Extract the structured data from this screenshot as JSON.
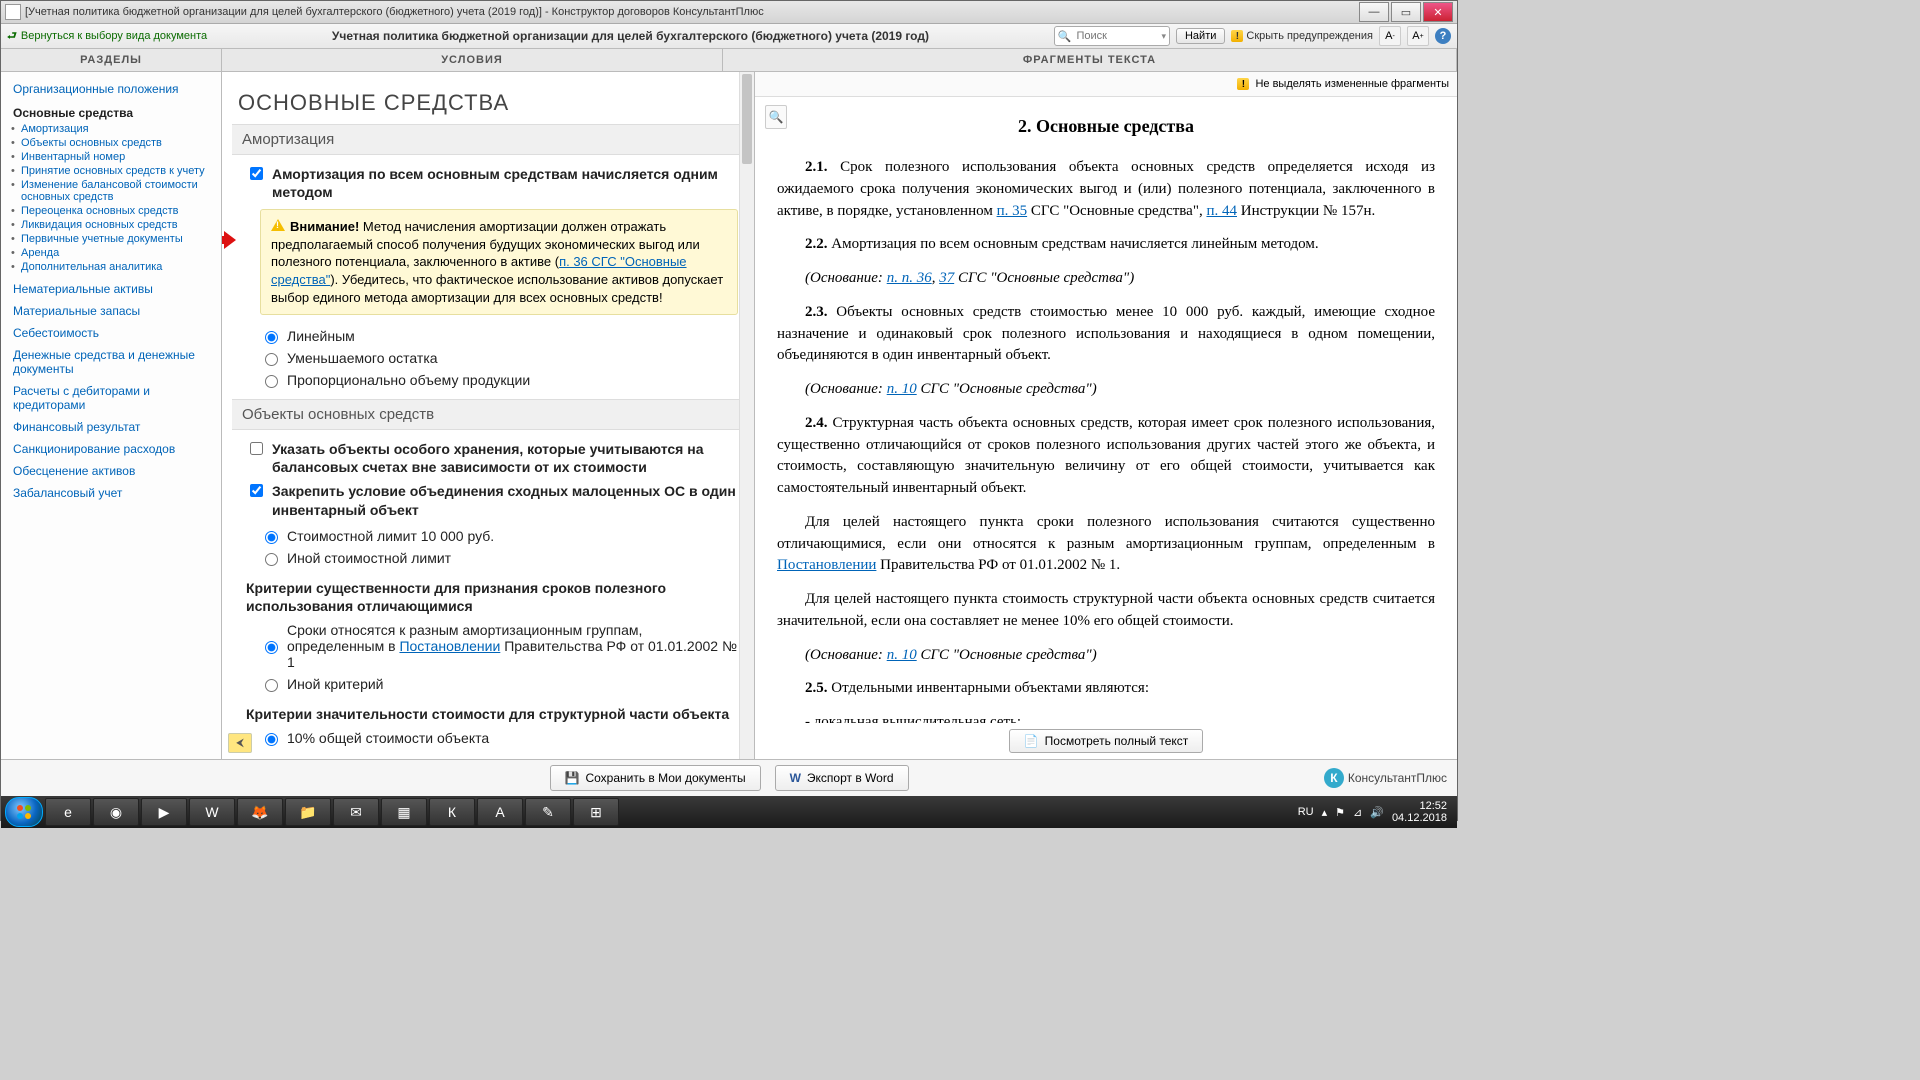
{
  "window": {
    "title": "[Учетная политика бюджетной организации для целей бухгалтерского (бюджетного) учета (2019 год)] - Конструктор договоров КонсультантПлюс"
  },
  "toolbar": {
    "back": "Вернуться к выбору вида документа",
    "title": "Учетная политика бюджетной организации для целей бухгалтерского (бюджетного) учета (2019 год)",
    "search_placeholder": "Поиск",
    "find": "Найти",
    "hide_warnings": "Скрыть предупреждения"
  },
  "headers": {
    "left": "РАЗДЕЛЫ",
    "middle": "УСЛОВИЯ",
    "right": "ФРАГМЕНТЫ ТЕКСТА"
  },
  "sidebar": {
    "link_org": "Организационные положения",
    "section_os": "Основные средства",
    "sub": [
      "Амортизация",
      "Объекты основных средств",
      "Инвентарный номер",
      "Принятие основных средств к учету",
      "Изменение балансовой стоимости основных средств",
      "Переоценка основных средств",
      "Ликвидация основных средств",
      "Первичные учетные документы",
      "Аренда",
      "Дополнительная аналитика"
    ],
    "links": [
      "Нематериальные активы",
      "Материальные запасы",
      "Себестоимость",
      "Денежные средства и денежные документы",
      "Расчеты с дебиторами и кредиторами",
      "Финансовый результат",
      "Санкционирование расходов",
      "Обесценение активов",
      "Забалансовый учет"
    ]
  },
  "middle": {
    "h1": "ОСНОВНЫЕ СРЕДСТВА",
    "sec_amort": "Амортизация",
    "opt_amort_all": "Амортизация по всем основным средствам начисляется одним методом",
    "warn_strong": "Внимание!",
    "warn_text1": " Метод начисления амортизации должен отражать предполагаемый способ получения будущих экономических выгод или полезного потенциала, заключенного в активе (",
    "warn_link": "п. 36 СГС \"Основные средства\"",
    "warn_text2": "). Убедитесь, что фактическое использование активов допускает выбор единого метода амортизации для всех основных средств!",
    "radio1": "Линейным",
    "radio2": "Уменьшаемого остатка",
    "radio3": "Пропорционально объему продукции",
    "sec_obj": "Объекты основных средств",
    "opt_special": "Указать объекты особого хранения, которые учитываются на балансовых счетах вне зависимости от их стоимости",
    "opt_combine": "Закрепить условие объединения сходных малоценных ОС в один инвентарный объект",
    "radio_cost1": "Стоимостной лимит 10 000 руб.",
    "radio_cost2": "Иной стоимостной лимит",
    "crit_title": "Критерии существенности для признания сроков полезного использования отличающимися",
    "radio_term1a": "Сроки относятся к разным амортизационным группам, определенным в ",
    "radio_term1_link": "Постановлении",
    "radio_term1b": " Правительства РФ от 01.01.2002 № 1",
    "radio_term2": "Иной критерий",
    "sig_title": "Критерии значительности стоимости для структурной части объекта",
    "radio_sig1": "10% общей стоимости объекта"
  },
  "right": {
    "no_highlight": "Не выделять измененные фрагменты",
    "heading": "2.  Основные средства",
    "p21a": "2.1.",
    "p21b": " Срок полезного использования объекта основных средств определяется исходя из ожидаемого срока получения экономических выгод и (или) полезного потенциала, заключенного в активе, в порядке, установленном ",
    "p21_l1": "п. 35",
    "p21c": " СГС \"Основные средства\", ",
    "p21_l2": "п. 44",
    "p21d": " Инструкции № 157н.",
    "p22a": "2.2.",
    "p22b": "  Амортизация по всем основным средствам начисляется линейным методом.",
    "p22_ref_a": "(Основание: ",
    "p22_ref_l1": "п. п. 36",
    "p22_ref_b": ", ",
    "p22_ref_l2": "37",
    "p22_ref_c": " СГС \"Основные средства\")",
    "p23a": "2.3.",
    "p23b": " Объекты основных средств стоимостью менее 10 000 руб. каждый, имеющие сходное назначение и одинаковый срок полезного использования и находящиеся в одном помещении, объединяются в один инвентарный объект.",
    "p23_ref_a": "(Основание: ",
    "p23_ref_l": "п. 10",
    "p23_ref_b": " СГС \"Основные средства\")",
    "p24a": "2.4.",
    "p24b": " Структурная часть объекта основных средств, которая имеет срок полезного использования, существенно отличающийся от сроков полезного использования других частей этого же объекта, и стоимость, составляющую значительную величину от его общей стоимости, учитывается как самостоятельный инвентарный объект.",
    "p24c": "Для целей настоящего пункта сроки полезного использования считаются существенно отличающимися, если они относятся к разным амортизационным группам, определенным в ",
    "p24_l": "Постановлении",
    "p24d": " Правительства РФ от 01.01.2002 № 1.",
    "p24e": "Для целей настоящего пункта стоимость структурной части объекта основных средств считается значительной, если она составляет не менее 10% его общей стоимости.",
    "p24_ref_a": "(Основание: ",
    "p24_ref_l": "п. 10",
    "p24_ref_b": " СГС \"Основные средства\")",
    "p25a": "2.5.",
    "p25b": "  Отдельными инвентарными объектами являются:",
    "p25c": "-  локальная вычислительная сеть;",
    "full_text": "Посмотреть полный текст"
  },
  "bottom": {
    "save": "Сохранить в Мои документы",
    "export": "Экспорт в Word",
    "brand": "КонсультантПлюс"
  },
  "tray": {
    "lang": "RU",
    "time": "12:52",
    "date": "04.12.2018"
  }
}
